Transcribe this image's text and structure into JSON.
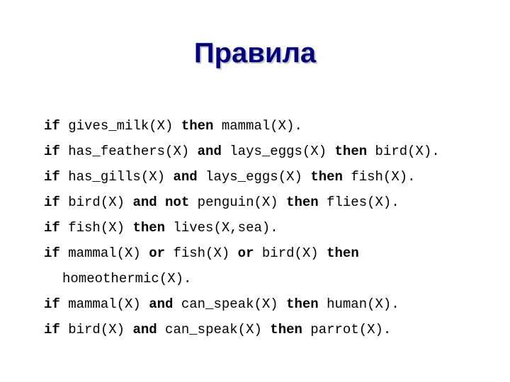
{
  "slide": {
    "title": "Правила",
    "title_color": "#000080",
    "shadow_color": "#c8c8c8",
    "background_color": "#ffffff",
    "text_color": "#000000",
    "rules": [
      {
        "id": "rule-mammal",
        "indented": false,
        "tokens": [
          {
            "t": "if",
            "bold": true
          },
          {
            "t": " gives_milk(X) ",
            "bold": false
          },
          {
            "t": "then",
            "bold": true
          },
          {
            "t": " mammal(X).",
            "bold": false
          }
        ]
      },
      {
        "id": "rule-bird",
        "indented": false,
        "tokens": [
          {
            "t": "if",
            "bold": true
          },
          {
            "t": " has_feathers(X) ",
            "bold": false
          },
          {
            "t": "and",
            "bold": true
          },
          {
            "t": " lays_eggs(X) ",
            "bold": false
          },
          {
            "t": "then",
            "bold": true
          },
          {
            "t": " bird(X).",
            "bold": false
          }
        ]
      },
      {
        "id": "rule-fish",
        "indented": false,
        "tokens": [
          {
            "t": "if",
            "bold": true
          },
          {
            "t": " has_gills(X) ",
            "bold": false
          },
          {
            "t": "and",
            "bold": true
          },
          {
            "t": " lays_eggs(X) ",
            "bold": false
          },
          {
            "t": "then",
            "bold": true
          },
          {
            "t": " fish(X).",
            "bold": false
          }
        ]
      },
      {
        "id": "rule-flies",
        "indented": false,
        "tokens": [
          {
            "t": "if",
            "bold": true
          },
          {
            "t": " bird(X) ",
            "bold": false
          },
          {
            "t": "and not",
            "bold": true
          },
          {
            "t": " penguin(X) ",
            "bold": false
          },
          {
            "t": "then",
            "bold": true
          },
          {
            "t": " flies(X).",
            "bold": false
          }
        ]
      },
      {
        "id": "rule-lives-sea",
        "indented": false,
        "tokens": [
          {
            "t": "if",
            "bold": true
          },
          {
            "t": " fish(X) ",
            "bold": false
          },
          {
            "t": "then",
            "bold": true
          },
          {
            "t": " lives(X,sea).",
            "bold": false
          }
        ]
      },
      {
        "id": "rule-homeothermic",
        "indented": false,
        "tokens": [
          {
            "t": "if",
            "bold": true
          },
          {
            "t": " mammal(X) ",
            "bold": false
          },
          {
            "t": "or",
            "bold": true
          },
          {
            "t": " fish(X) ",
            "bold": false
          },
          {
            "t": "or",
            "bold": true
          },
          {
            "t": " bird(X) ",
            "bold": false
          },
          {
            "t": "then",
            "bold": true
          }
        ]
      },
      {
        "id": "rule-homeothermic-cont",
        "indented": true,
        "tokens": [
          {
            "t": "homeothermic(X).",
            "bold": false
          }
        ]
      },
      {
        "id": "rule-human",
        "indented": false,
        "tokens": [
          {
            "t": "if",
            "bold": true
          },
          {
            "t": " mammal(X) ",
            "bold": false
          },
          {
            "t": "and",
            "bold": true
          },
          {
            "t": " can_speak(X) ",
            "bold": false
          },
          {
            "t": "then",
            "bold": true
          },
          {
            "t": " human(X).",
            "bold": false
          }
        ]
      },
      {
        "id": "rule-parrot",
        "indented": false,
        "tokens": [
          {
            "t": "if",
            "bold": true
          },
          {
            "t": " bird(X) ",
            "bold": false
          },
          {
            "t": "and",
            "bold": true
          },
          {
            "t": " can_speak(X) ",
            "bold": false
          },
          {
            "t": "then",
            "bold": true
          },
          {
            "t": " parrot(X).",
            "bold": false
          }
        ]
      }
    ]
  }
}
